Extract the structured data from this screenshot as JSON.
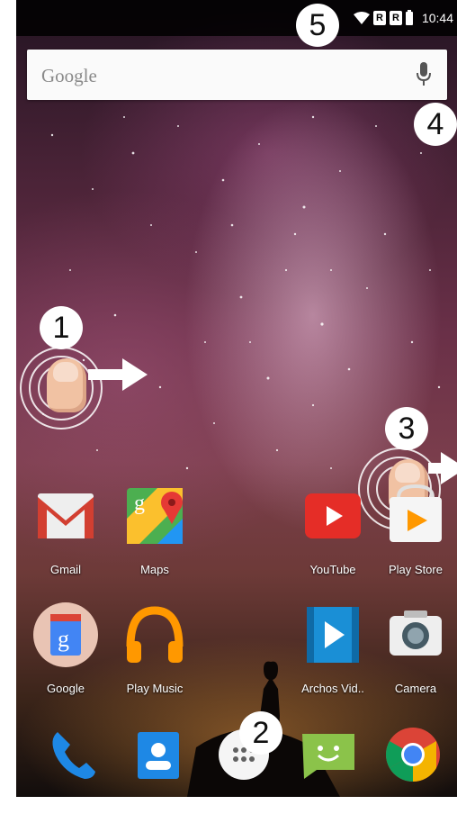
{
  "status_bar": {
    "time": "10:44",
    "sim_label": "R"
  },
  "search": {
    "label": "Google"
  },
  "callouts": [
    "1",
    "2",
    "3",
    "4",
    "5"
  ],
  "apps_row1": [
    {
      "label": "Gmail",
      "icon": "gmail-icon"
    },
    {
      "label": "Maps",
      "icon": "maps-icon"
    },
    {
      "label": "YouTube",
      "icon": "youtube-icon"
    },
    {
      "label": "Play Store",
      "icon": "play-store-icon"
    }
  ],
  "apps_row2": [
    {
      "label": "Google",
      "icon": "google-folder-icon"
    },
    {
      "label": "Play Music",
      "icon": "play-music-icon"
    },
    {
      "label": "Archos Vid..",
      "icon": "archos-video-icon"
    },
    {
      "label": "Camera",
      "icon": "camera-icon"
    }
  ],
  "dock": [
    "phone-icon",
    "contacts-icon",
    "app-drawer-icon",
    "messaging-icon",
    "chrome-icon"
  ],
  "colors": {
    "gmail_red": "#d23f31",
    "youtube_red": "#e52d27",
    "video_blue": "#1a8fd6",
    "hangouts_green": "#8bc34a"
  }
}
